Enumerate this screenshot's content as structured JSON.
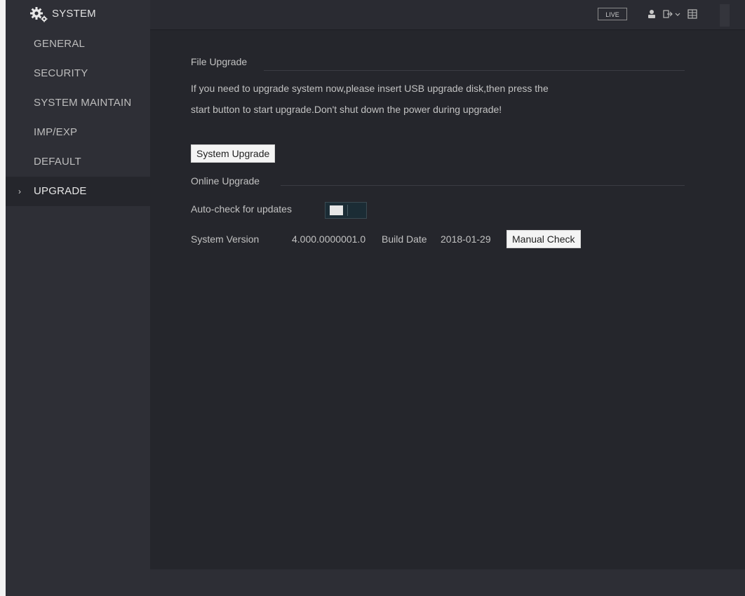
{
  "topbar": {
    "title": "SYSTEM",
    "live_label": "LIVE",
    "icons": [
      "gear-icon",
      "user-icon",
      "logout-icon",
      "menu-icon"
    ]
  },
  "sidebar": {
    "items": [
      {
        "label": "GENERAL",
        "active": false
      },
      {
        "label": "SECURITY",
        "active": false
      },
      {
        "label": "SYSTEM MAINTAIN",
        "active": false
      },
      {
        "label": "IMP/EXP",
        "active": false
      },
      {
        "label": "DEFAULT",
        "active": false
      },
      {
        "label": "UPGRADE",
        "active": true
      }
    ]
  },
  "file_upgrade": {
    "heading": "File Upgrade",
    "description_line1": "If you need to upgrade system now,please insert USB upgrade disk,then press the",
    "description_line2": "start button to start upgrade.Don't shut down the power during upgrade!",
    "button_label": "System Upgrade"
  },
  "online_upgrade": {
    "heading": "Online Upgrade",
    "auto_check_label": "Auto-check for updates",
    "auto_check_enabled": false,
    "version_label": "System Version",
    "version_value": "4.000.0000001.0",
    "build_date_label": "Build Date",
    "build_date_value": "2018-01-29",
    "manual_check_label": "Manual Check"
  },
  "colors": {
    "background": "#25262c",
    "sidebar": "#2e2f36",
    "text": "#c2c2c2",
    "button_bg": "#f4f4f4"
  }
}
